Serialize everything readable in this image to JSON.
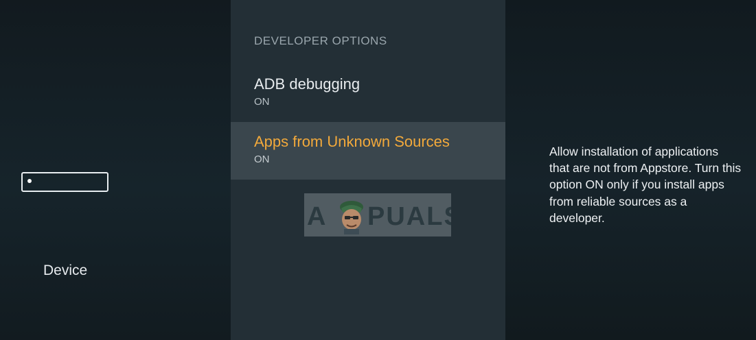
{
  "sidebar": {
    "category_label": "Device",
    "icon": "fire-tv-device-icon"
  },
  "menu": {
    "section_header": "DEVELOPER OPTIONS",
    "items": [
      {
        "title": "ADB debugging",
        "value": "ON",
        "selected": false
      },
      {
        "title": "Apps from Unknown Sources",
        "value": "ON",
        "selected": true
      }
    ],
    "highlight_color": "#f2a93b"
  },
  "description": {
    "text": "Allow installation of applications that are not from Appstore. Turn this option ON only if you install apps from reliable sources as a developer."
  },
  "watermark": {
    "text": "APPUALS"
  }
}
